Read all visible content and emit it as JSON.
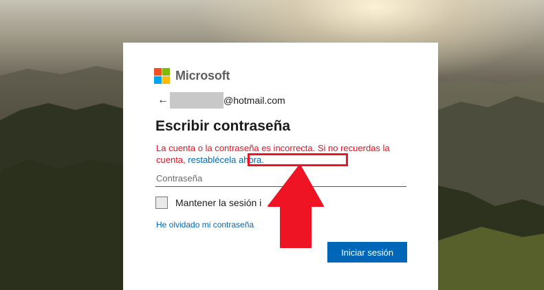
{
  "brand": {
    "name": "Microsoft",
    "logo_colors": [
      "#f25022",
      "#7fba00",
      "#00a4ef",
      "#ffb900"
    ]
  },
  "identity": {
    "back_icon": "back-arrow-icon",
    "back_glyph": "←",
    "email_domain": "@hotmail.com"
  },
  "page": {
    "title": "Escribir contraseña"
  },
  "error": {
    "message": "La cuenta o la contraseña es incorrecta. Si no recuerdas la cuenta,",
    "reset_link": "restablécela ahora.",
    "color": "#e81123"
  },
  "password": {
    "placeholder": "Contraseña",
    "value": ""
  },
  "keep_signed_in": {
    "label": "Mantener la sesión i",
    "checked": false
  },
  "forgot_password": "He olvidado mi contraseña",
  "signin_button": "Iniciar sesión",
  "annotation": {
    "arrow_icon": "up-arrow-icon",
    "color": "#ee1424"
  },
  "colors": {
    "primary": "#0067b8",
    "error": "#e81123"
  }
}
